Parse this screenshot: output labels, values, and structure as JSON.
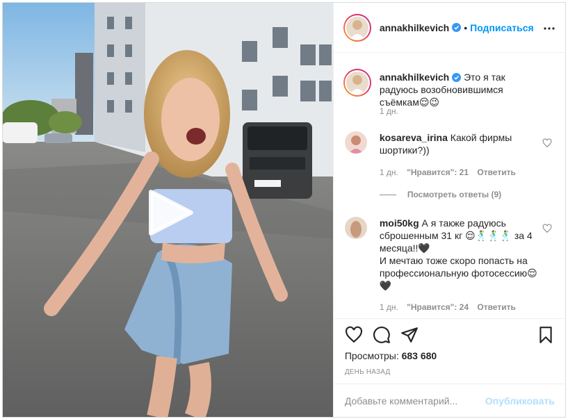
{
  "post": {
    "author": {
      "username": "annakhilkevich",
      "verified": true,
      "follow_label": "Подписаться"
    },
    "caption": {
      "username": "annakhilkevich",
      "text": "Это я так радуюсь возобновившимся съёмкам😌😉",
      "time": "1 дн."
    },
    "comments": [
      {
        "username": "kosareva_irina",
        "text": "Какой фирмы шортики?))",
        "time": "1 дн.",
        "likes": "\"Нравится\": 21",
        "reply_label": "Ответить",
        "view_replies": "Посмотреть ответы (9)"
      },
      {
        "username": "moi50kg",
        "text": "А я также радуюсь сброшенным 31 кг 😌🕺🕺🕺 за 4 месяца!!🖤",
        "text2": "И мечтаю тоже скоро попасть на профессиональную фотосессию😌🖤",
        "time": "1 дн.",
        "likes": "\"Нравится\": 24",
        "reply_label": "Ответить"
      }
    ],
    "views_label": "Просмотры:",
    "views_count": "683 680",
    "posted": "День назад",
    "comment_placeholder": "Добавьте комментарий...",
    "publish_label": "Опубликовать"
  },
  "icons": [
    "verified-badge-icon",
    "more-options-icon",
    "heart-icon",
    "comment-icon",
    "share-icon",
    "bookmark-icon",
    "play-icon"
  ],
  "colors": {
    "link_blue": "#0095f6",
    "publish_disabled": "#b2dffc",
    "muted": "#8e8e8e",
    "text": "#262626",
    "border": "#dbdbdb"
  }
}
